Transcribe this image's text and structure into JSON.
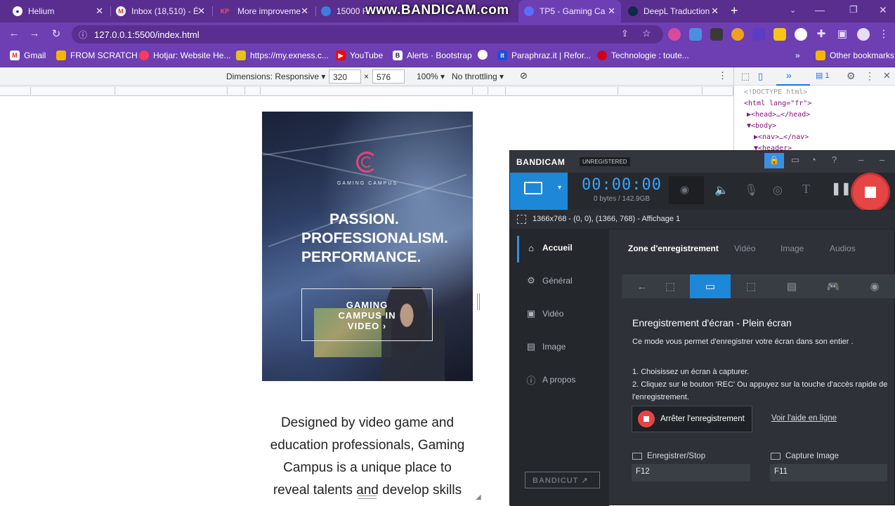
{
  "browser": {
    "tabs": [
      {
        "title": "Helium",
        "favicon_color": "#4a2a7a"
      },
      {
        "title": "Inbox (18,510) - É",
        "favicon_color": "#d93025"
      },
      {
        "title": "More improveme",
        "favicon_color": "#e0245e"
      },
      {
        "title": "15000 F",
        "favicon_color": "#3c7de0"
      },
      {
        "title": "TP5 - Gaming Ca",
        "favicon_color": "#5b6cff"
      },
      {
        "title": "DeepL Traduction",
        "favicon_color": "#0f2b46"
      }
    ],
    "tab_favicon_text": {
      "gmail": "M",
      "kp": "KP"
    },
    "new_tab_label": "+",
    "url": "127.0.0.1:5500/index.html",
    "bookmarks": [
      {
        "label": "Gmail",
        "icon_color": "#d93025"
      },
      {
        "label": "FROM SCRATCH",
        "icon_color": "#f2b600"
      },
      {
        "label": "Hotjar: Website He...",
        "icon_color": "#fd3a5c"
      },
      {
        "label": "https://my.exness.c...",
        "icon_color": "#e3c31c"
      },
      {
        "label": "YouTube",
        "icon_color": "#ff0000"
      },
      {
        "label": "Alerts · Bootstrap",
        "icon_color": "#222222"
      },
      {
        "label": "Paraphraz.it | Refor...",
        "icon_color": "#1a4fd6"
      },
      {
        "label": "Technologie : toute...",
        "icon_color": "#d0021b"
      }
    ],
    "bookmarks_overflow": "»",
    "other_bookmarks": "Other bookmarks",
    "watermark": "www.BANDICAM.com"
  },
  "devtools": {
    "dimensions_label": "Dimensions: Responsive",
    "width": "320",
    "times": "×",
    "height": "576",
    "zoom": "100%",
    "throttling": "No throttling",
    "console_count": "1",
    "elements": [
      "<!DOCTYPE html>",
      "<html lang=\"fr\">",
      "▶<head>…</head>",
      "▼<body>",
      "▶<nav>…</nav>",
      "▼<header>"
    ]
  },
  "site": {
    "brand": "GAMING CAMPUS",
    "headline": [
      "PASSION.",
      "PROFESSIONALISM.",
      "PERFORMANCE."
    ],
    "cta": [
      "GAMING",
      "CAMPUS IN",
      "VIDEO ›"
    ],
    "body": [
      "Designed by video game and",
      "education professionals, Gaming",
      "Campus is a unique place to",
      "reveal talents and develop skills"
    ]
  },
  "bandicam": {
    "logo": "BANDICAM",
    "unregistered": "UNREGISTERED",
    "timer": "00:00:00",
    "bytes": "0 bytes / 142.9GB",
    "resolution": "1366x768 - (0, 0), (1366, 768) - Affichage 1",
    "sidebar": [
      "Accueil",
      "Général",
      "Vidéo",
      "Image",
      "A propos"
    ],
    "subtabs": [
      "Zone d'enregistrement",
      "Vidéo",
      "Image",
      "Audios"
    ],
    "content_title": "Enregistrement d'écran - Plein écran",
    "content_desc": "Ce mode vous permet d'enregistrer votre écran dans son entier .",
    "step1": "1. Choisissez un écran à capturer.",
    "step2a": "2. Cliquez sur le bouton 'REC' Ou appuyez sur la touche d'accès rapide de",
    "step2b": "l'enregistrement.",
    "stop_button": "Arrêter l'enregistrement",
    "help_link": "Voir l'aide en ligne",
    "hotkey_record_label": "Enregistrer/Stop",
    "hotkey_record_value": "F12",
    "hotkey_capture_label": "Capture Image",
    "hotkey_capture_value": "F11",
    "bandicut": "BANDICUT ↗",
    "accent": "#1e88d8",
    "rec_color": "#e64545"
  }
}
